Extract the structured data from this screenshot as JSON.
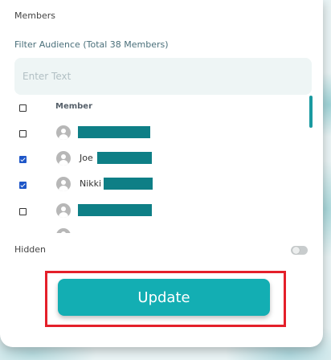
{
  "members_section": {
    "label": "Members",
    "filter_label": "Filter Audience (Total 38 Members)",
    "search_placeholder": "Enter Text",
    "column_header": "Member",
    "rows": [
      {
        "checked": false,
        "name": ""
      },
      {
        "checked": true,
        "name": "Joe"
      },
      {
        "checked": true,
        "name": "Nikki"
      },
      {
        "checked": false,
        "name": ""
      }
    ]
  },
  "hidden": {
    "label": "Hidden",
    "enabled": false
  },
  "actions": {
    "update_label": "Update"
  },
  "colors": {
    "accent": "#13aeb3",
    "redaction": "#0e7f86",
    "checkbox_checked": "#1e56c8",
    "highlight_border": "#e4202a"
  }
}
